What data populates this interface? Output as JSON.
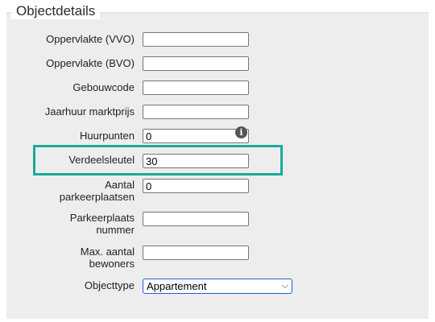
{
  "section": {
    "legend": "Objectdetails"
  },
  "fields": {
    "oppervlakte_vvo": {
      "label": "Oppervlakte (VVO)",
      "value": ""
    },
    "oppervlakte_bvo": {
      "label": "Oppervlakte (BVO)",
      "value": ""
    },
    "gebouwcode": {
      "label": "Gebouwcode",
      "value": ""
    },
    "jaarhuur": {
      "label": "Jaarhuur marktprijs",
      "value": ""
    },
    "huurpunten": {
      "label": "Huurpunten",
      "value": "0",
      "info_icon": "info-icon"
    },
    "verdeelsleutel": {
      "label": "Verdeelsleutel",
      "value": "30"
    },
    "aantal_parkeer": {
      "label_line1": "Aantal",
      "label_line2": "parkeerplaatsen",
      "value": "0"
    },
    "parkeerplaats_nummer": {
      "label_line1": "Parkeerplaats",
      "label_line2": "nummer",
      "value": ""
    },
    "max_bewoners": {
      "label_line1": "Max. aantal",
      "label_line2": "bewoners",
      "value": ""
    },
    "objecttype": {
      "label": "Objecttype",
      "selected": "Appartement",
      "dropdown_icon": "chevron-down-icon"
    }
  },
  "colors": {
    "highlight": "#1aab96",
    "panel": "#ededed",
    "select_border": "#1f5fcf"
  }
}
